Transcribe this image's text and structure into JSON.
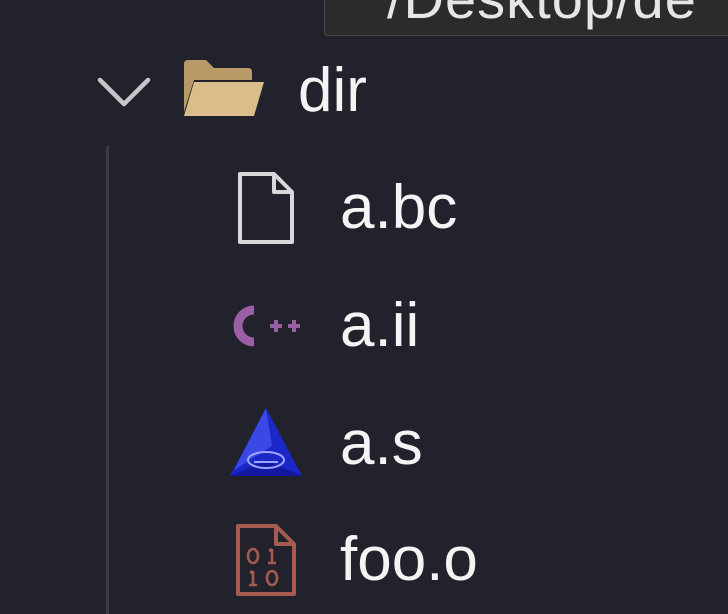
{
  "tooltip": {
    "text": "/Desktop/de"
  },
  "tree": {
    "folder": {
      "name": "dir",
      "expanded": true,
      "icon": "folder-open-icon",
      "icon_color": "#d2b583"
    },
    "files": [
      {
        "name": "a.bc",
        "icon": "file-icon",
        "icon_color": "#d8d8d8"
      },
      {
        "name": "a.ii",
        "icon": "cpp-icon",
        "icon_color": "#9b5fa6"
      },
      {
        "name": "a.s",
        "icon": "assembly-icon",
        "icon_color": "#1c27c8"
      },
      {
        "name": "foo.o",
        "icon": "binary-file-icon",
        "icon_color": "#a65a50"
      }
    ]
  },
  "theme": {
    "background": "#21222c",
    "text": "#f4f4f4",
    "guide": "#3a3b45"
  }
}
